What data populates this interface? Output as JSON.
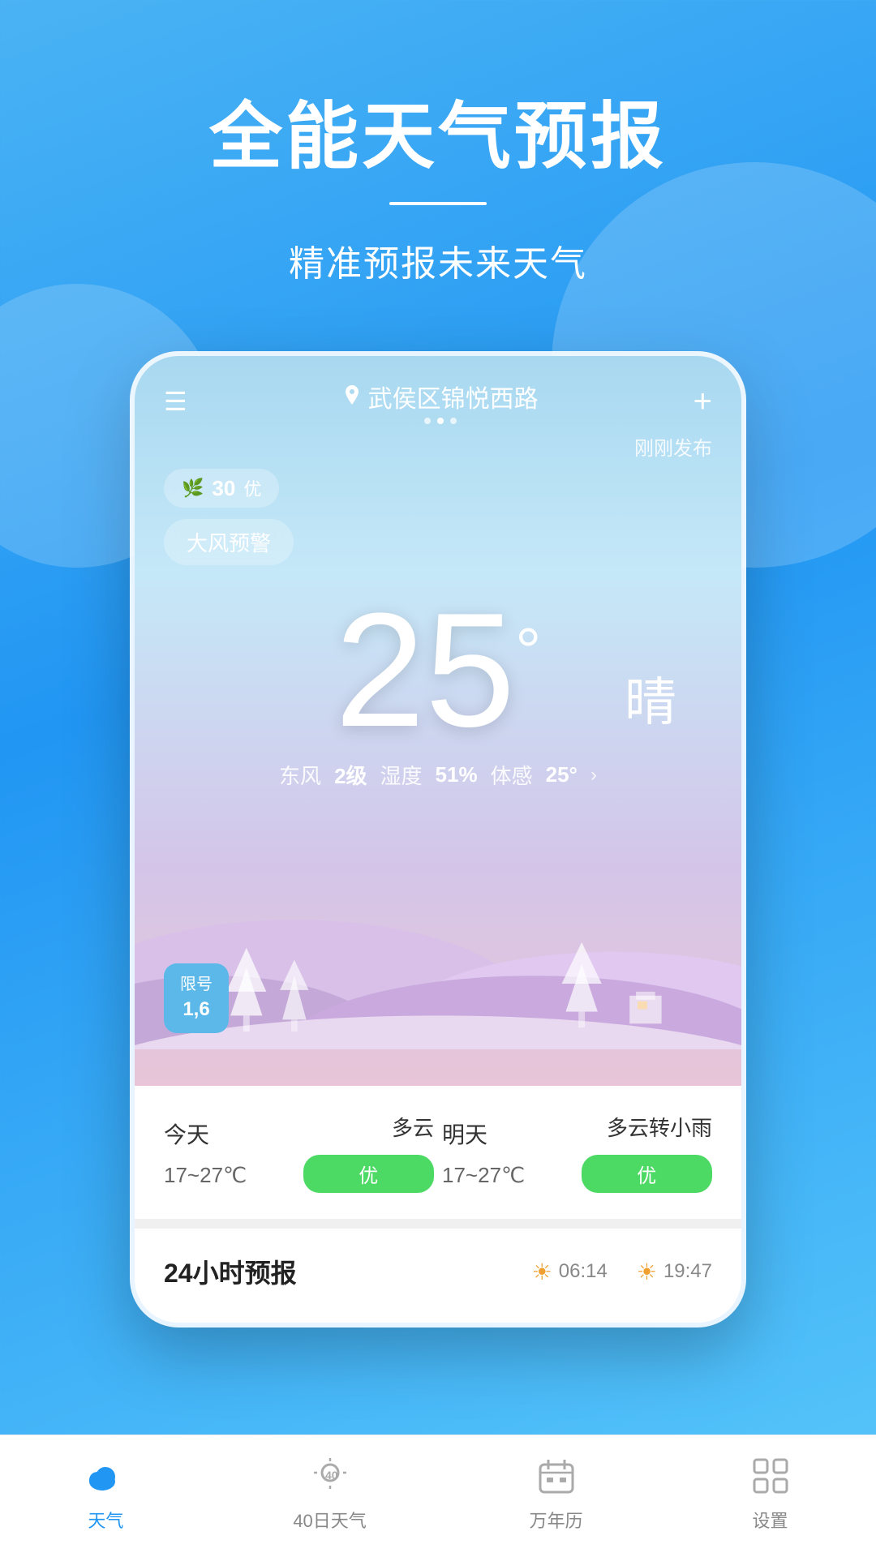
{
  "hero": {
    "title": "全能天气预报",
    "subtitle": "精准预报未来天气"
  },
  "phone": {
    "topbar": {
      "location": "武侯区锦悦西路",
      "menu_label": "menu",
      "plus_label": "+"
    },
    "dots": [
      false,
      true,
      false
    ],
    "just_published": "刚刚发布",
    "aqi": {
      "number": "30",
      "level": "优"
    },
    "wind_warning": "大风预警",
    "temperature": "25",
    "degree_symbol": "°",
    "condition": "晴",
    "details": {
      "wind": "东风",
      "wind_level": "2级",
      "humidity_label": "湿度",
      "humidity": "51%",
      "feel_label": "体感",
      "feel_temp": "25°"
    },
    "limit_badge": {
      "title": "限号",
      "numbers": "1,6"
    }
  },
  "weather_summary": {
    "today": {
      "day": "今天",
      "condition": "多云",
      "temp": "17~27℃",
      "quality": "优"
    },
    "tomorrow": {
      "day": "明天",
      "condition": "多云转小雨",
      "temp": "17~27℃",
      "quality": "优"
    }
  },
  "forecast_section": {
    "title": "24小时预报",
    "sunrise": "06:14",
    "sunset": "19:47"
  },
  "bottom_nav": {
    "items": [
      {
        "label": "天气",
        "icon": "☁",
        "active": true
      },
      {
        "label": "40日天气",
        "icon": "☀",
        "active": false
      },
      {
        "label": "万年历",
        "icon": "📅",
        "active": false
      },
      {
        "label": "设置",
        "icon": "⊞",
        "active": false
      }
    ]
  }
}
